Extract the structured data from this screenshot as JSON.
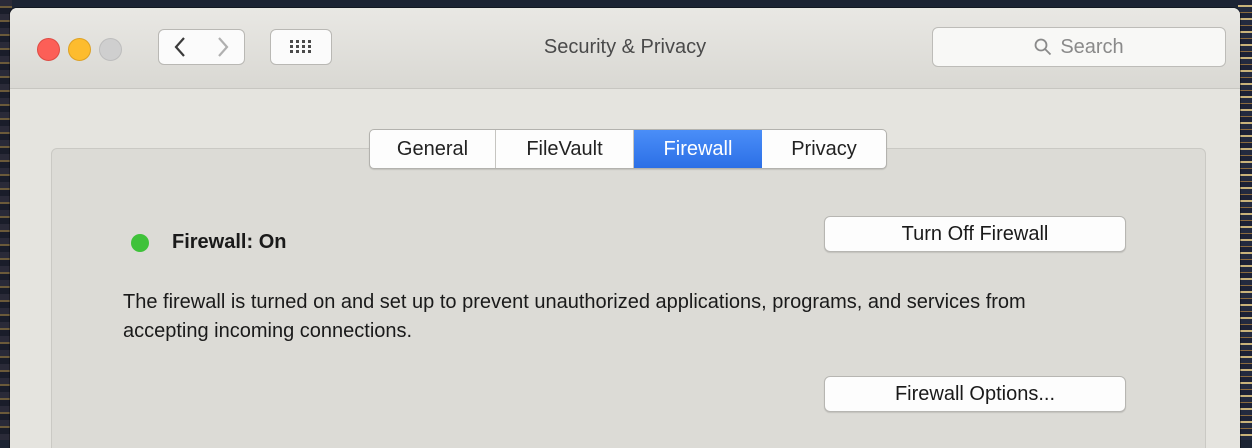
{
  "window": {
    "title": "Security & Privacy",
    "search": {
      "placeholder": "Search"
    }
  },
  "tabs": [
    {
      "label": "General",
      "selected": false
    },
    {
      "label": "FileVault",
      "selected": false
    },
    {
      "label": "Firewall",
      "selected": true
    },
    {
      "label": "Privacy",
      "selected": false
    }
  ],
  "firewall": {
    "status_label": "Firewall: On",
    "status_color": "#3fc23a",
    "turn_off_label": "Turn Off Firewall",
    "description": "The firewall is turned on and set up to prevent unauthorized applications, programs, and services from accepting incoming connections.",
    "options_label": "Firewall Options..."
  },
  "colors": {
    "accent": "#2c6fe6",
    "close": "#fc5f57",
    "minimize": "#fdbc2e"
  }
}
